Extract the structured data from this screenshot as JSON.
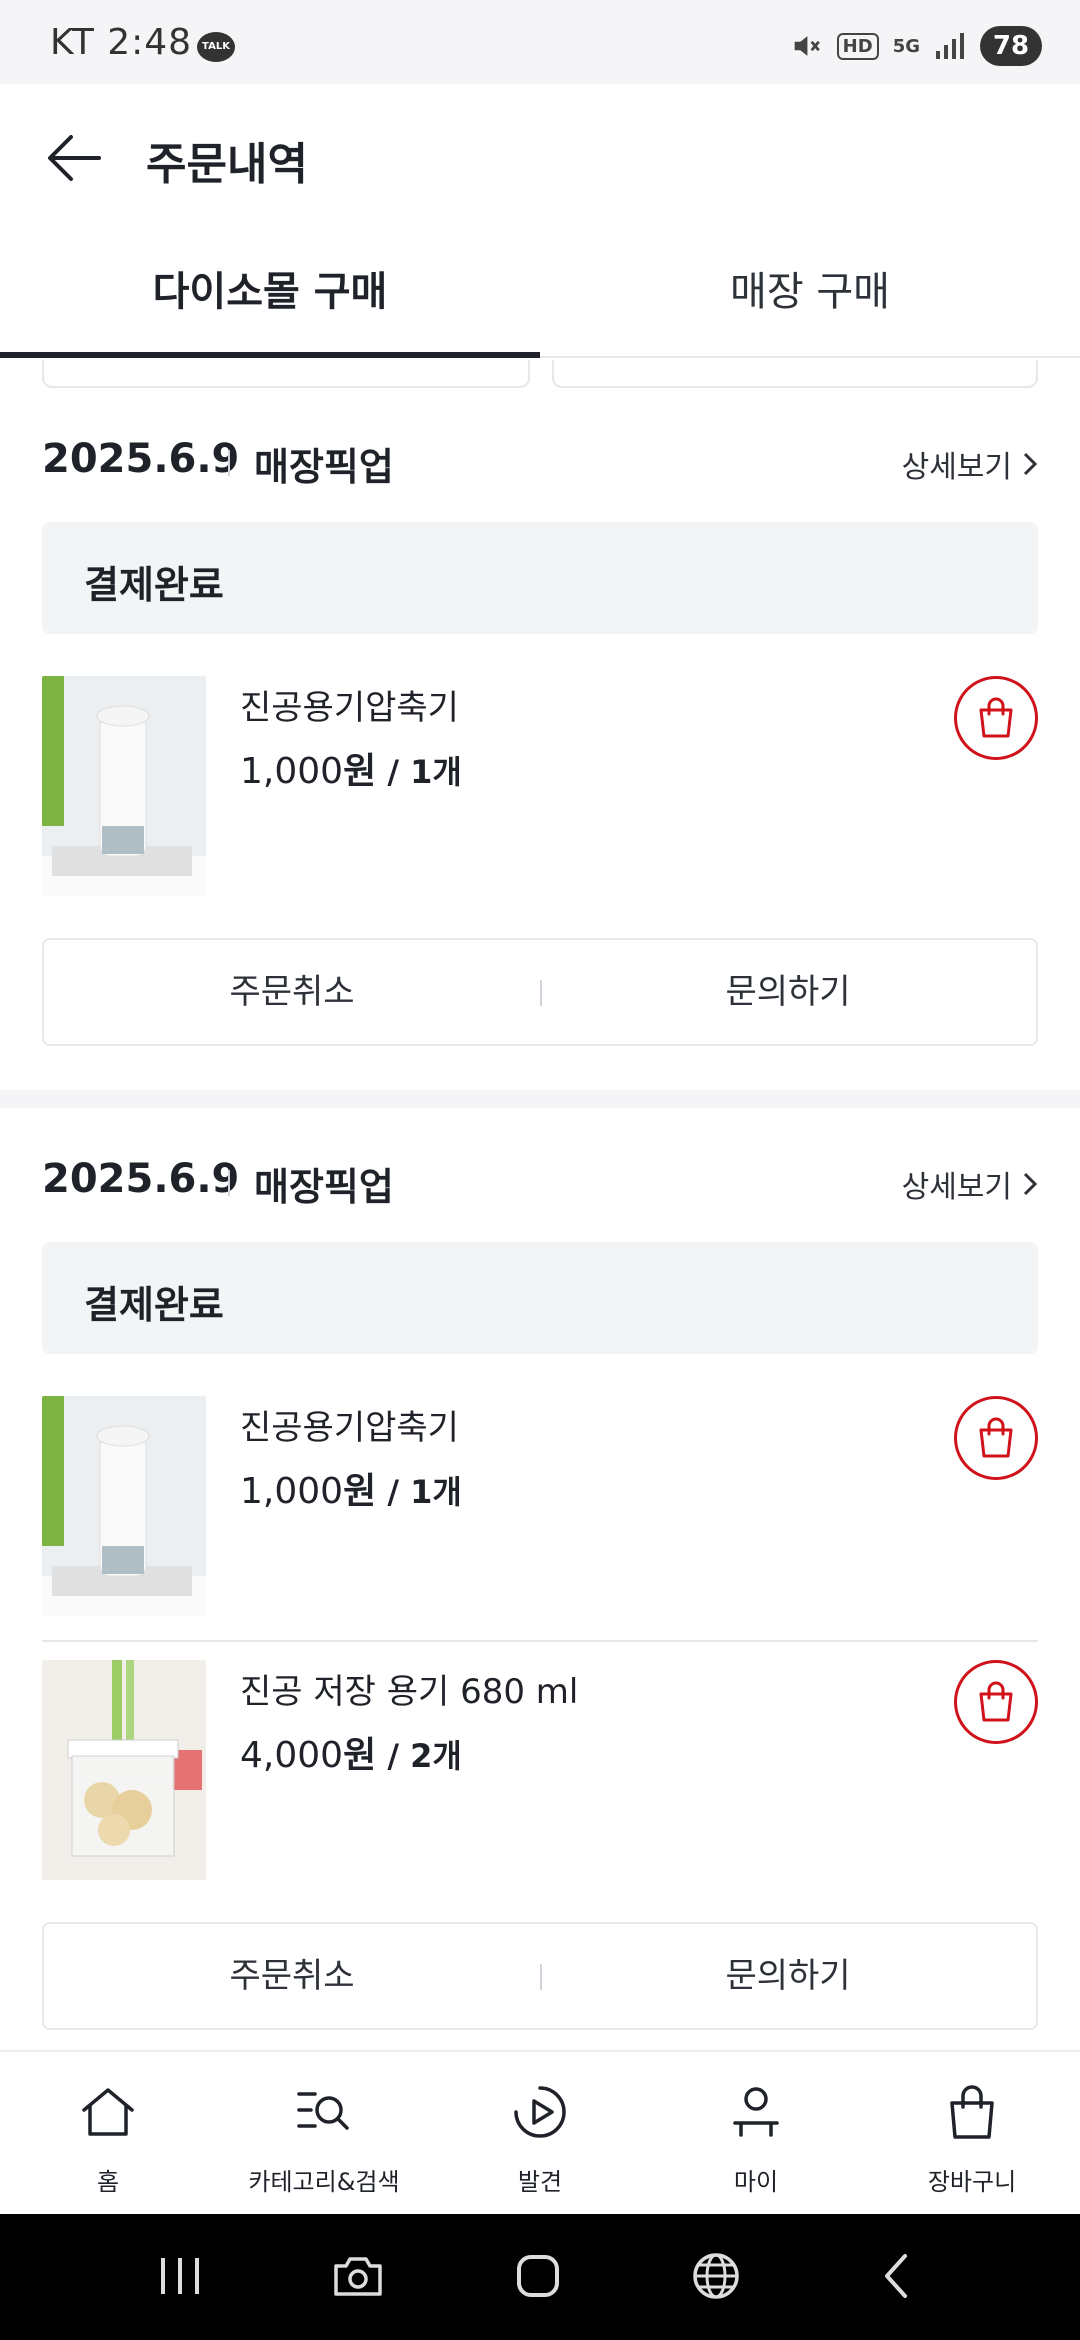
{
  "status_bar": {
    "carrier_time": "KT 2:48",
    "talk_badge": "TALK",
    "hd_label": "HD",
    "network_label": "5G",
    "battery": "78"
  },
  "header": {
    "title": "주문내역"
  },
  "tabs": [
    {
      "label": "다이소몰 구매",
      "active": true
    },
    {
      "label": "매장 구매",
      "active": false
    }
  ],
  "orders": [
    {
      "date": "2025.6.9",
      "type": "매장픽업",
      "detail_label": "상세보기",
      "status": "결제완료",
      "items": [
        {
          "name": "진공용기압축기",
          "price": "1,000",
          "currency": "원",
          "qty": " / 1개"
        }
      ],
      "actions": {
        "cancel": "주문취소",
        "inquiry": "문의하기"
      }
    },
    {
      "date": "2025.6.9",
      "type": "매장픽업",
      "detail_label": "상세보기",
      "status": "결제완료",
      "items": [
        {
          "name": "진공용기압축기",
          "price": "1,000",
          "currency": "원",
          "qty": " / 1개"
        },
        {
          "name": "진공 저장 용기 680 ml",
          "price": "4,000",
          "currency": "원",
          "qty": " / 2개"
        }
      ],
      "actions": {
        "cancel": "주문취소",
        "inquiry": "문의하기"
      }
    }
  ],
  "bottom_nav": [
    {
      "label": "홈",
      "icon": "home-icon"
    },
    {
      "label": "카테고리&검색",
      "icon": "category-search-icon"
    },
    {
      "label": "발견",
      "icon": "discover-play-icon"
    },
    {
      "label": "마이",
      "icon": "person-icon"
    },
    {
      "label": "장바구니",
      "icon": "shopping-bag-icon"
    }
  ],
  "colors": {
    "accent_red": "#d0121b",
    "text_dark": "#1f2329",
    "status_bg": "#f3f4f6"
  }
}
